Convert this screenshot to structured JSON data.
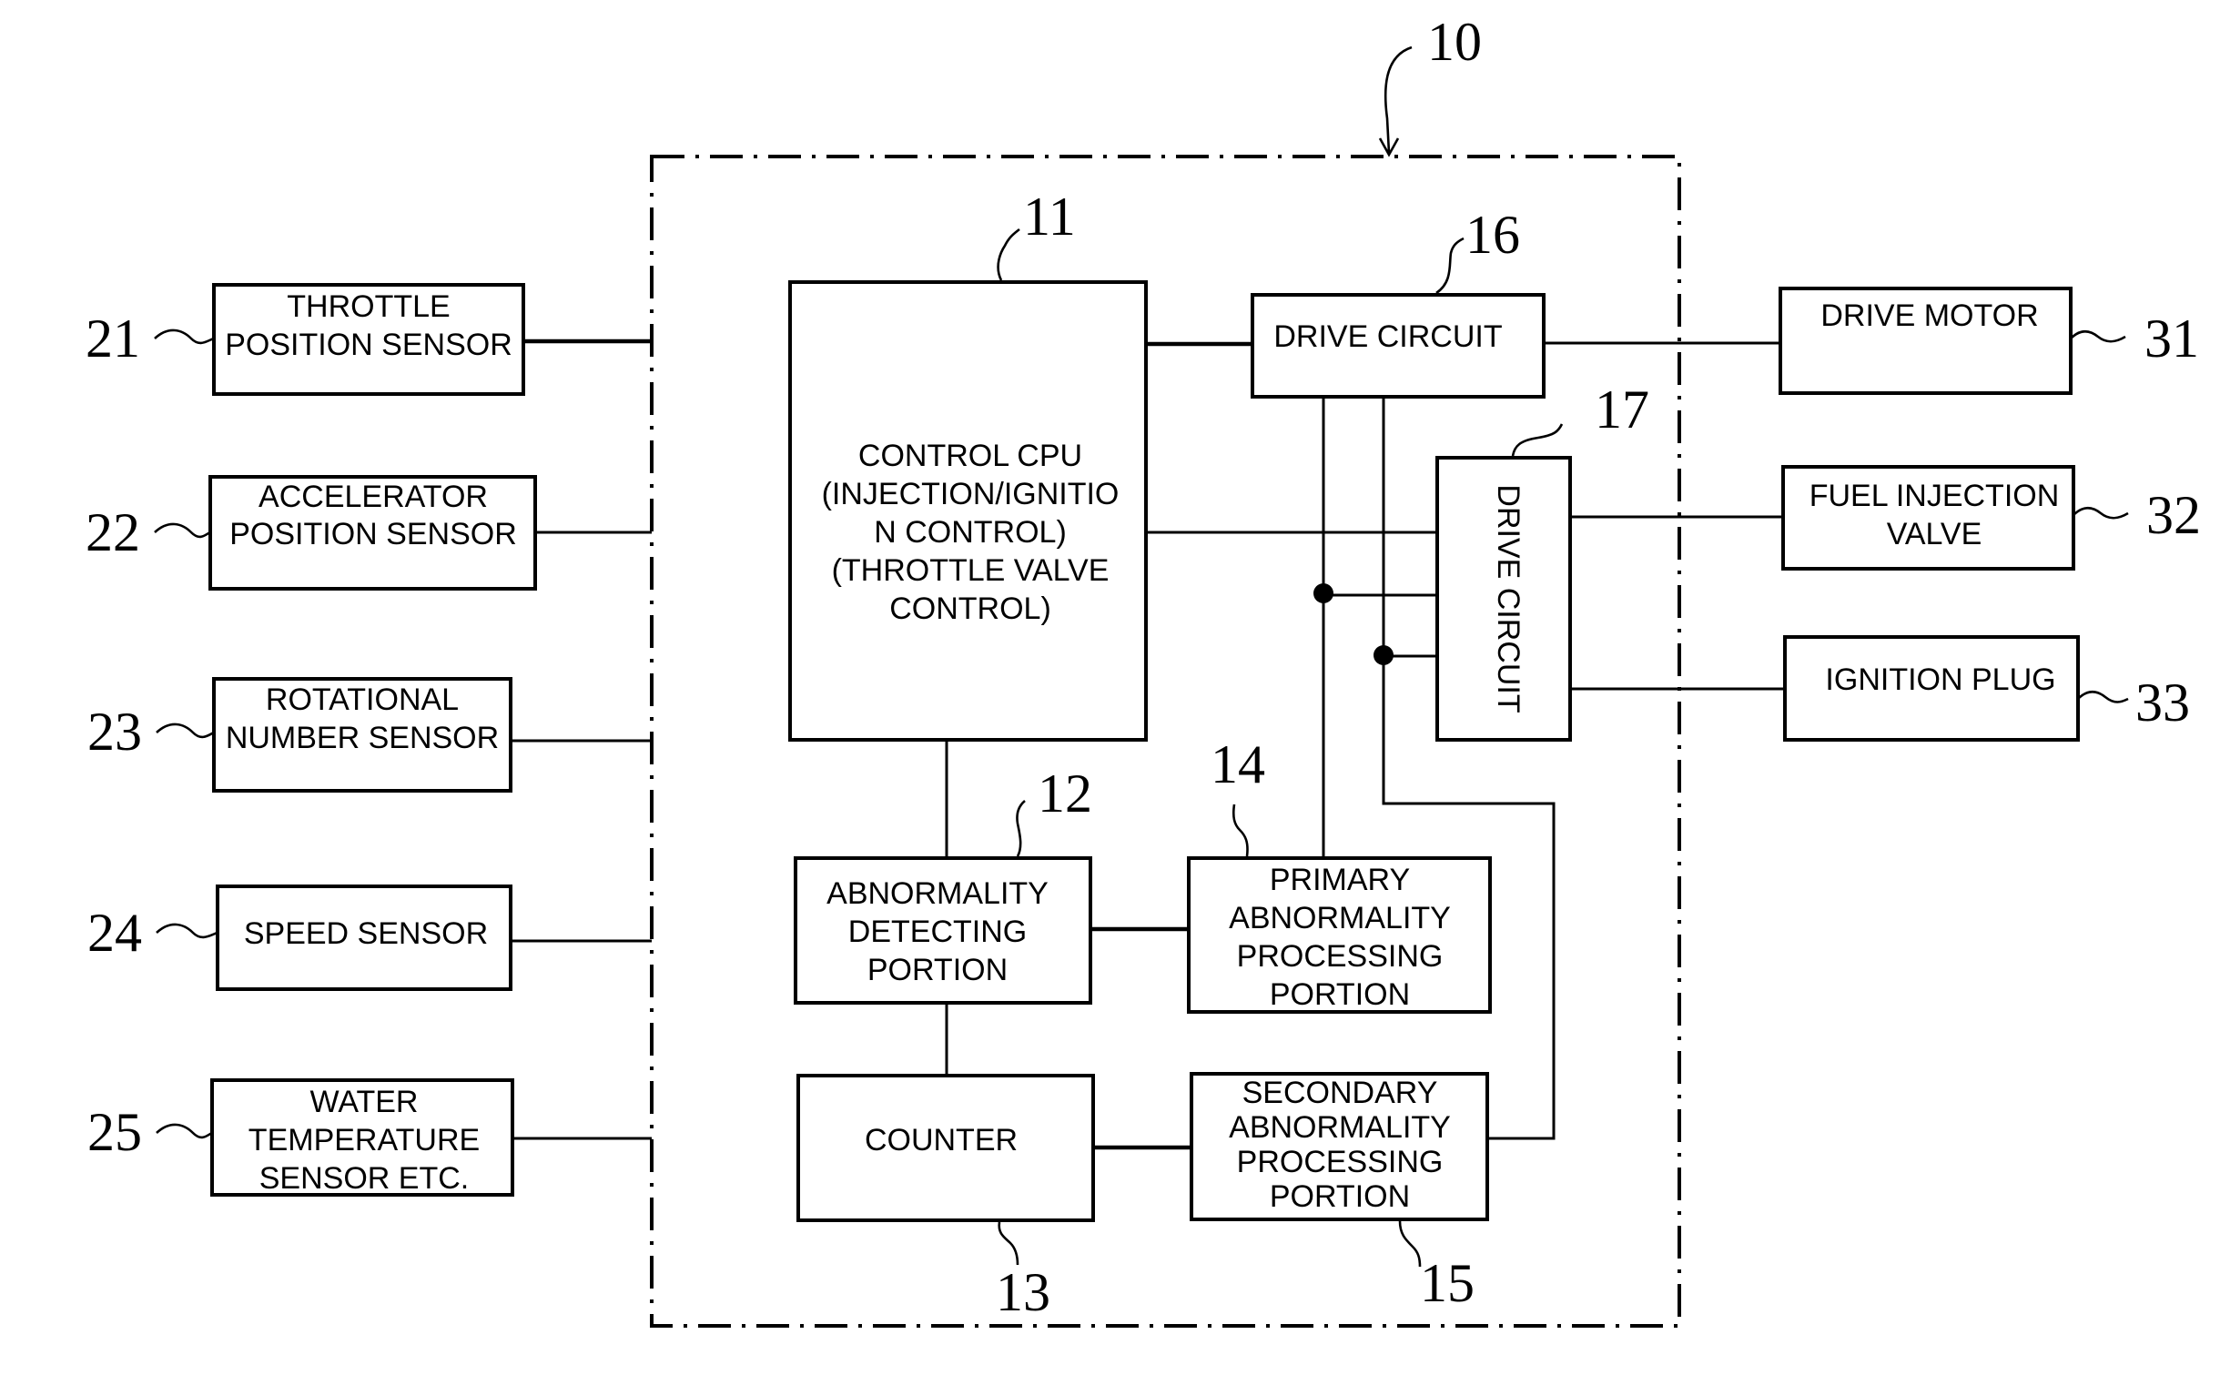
{
  "figure": {
    "system_ref": "10"
  },
  "sensors": [
    {
      "ref": "21",
      "lines": [
        "THROTTLE",
        "POSITION SENSOR"
      ]
    },
    {
      "ref": "22",
      "lines": [
        "ACCELERATOR",
        "POSITION SENSOR"
      ]
    },
    {
      "ref": "23",
      "lines": [
        "ROTATIONAL",
        "NUMBER SENSOR"
      ]
    },
    {
      "ref": "24",
      "lines": [
        "SPEED SENSOR"
      ]
    },
    {
      "ref": "25",
      "lines": [
        "WATER",
        "TEMPERATURE",
        "SENSOR ETC."
      ]
    }
  ],
  "controller": {
    "cpu": {
      "ref": "11",
      "lines": [
        "CONTROL CPU",
        "(INJECTION/IGNITIO",
        "N CONTROL)",
        "(THROTTLE VALVE",
        "CONTROL)"
      ]
    },
    "abnormality_detecting": {
      "ref": "12",
      "lines": [
        "ABNORMALITY",
        "DETECTING",
        "PORTION"
      ]
    },
    "counter": {
      "ref": "13",
      "lines": [
        "COUNTER"
      ]
    },
    "primary_processing": {
      "ref": "14",
      "lines": [
        "PRIMARY",
        "ABNORMALITY",
        "PROCESSING",
        "PORTION"
      ]
    },
    "secondary_processing": {
      "ref": "15",
      "lines": [
        "SECONDARY",
        "ABNORMALITY",
        "PROCESSING",
        "PORTION"
      ]
    },
    "drive_circuit_1": {
      "ref": "16",
      "label": "DRIVE CIRCUIT"
    },
    "drive_circuit_2": {
      "ref": "17",
      "label": "DRIVE CIRCUIT"
    }
  },
  "actuators": [
    {
      "ref": "31",
      "lines": [
        "DRIVE MOTOR"
      ]
    },
    {
      "ref": "32",
      "lines": [
        "FUEL INJECTION",
        "VALVE"
      ]
    },
    {
      "ref": "33",
      "lines": [
        "IGNITION PLUG"
      ]
    }
  ]
}
